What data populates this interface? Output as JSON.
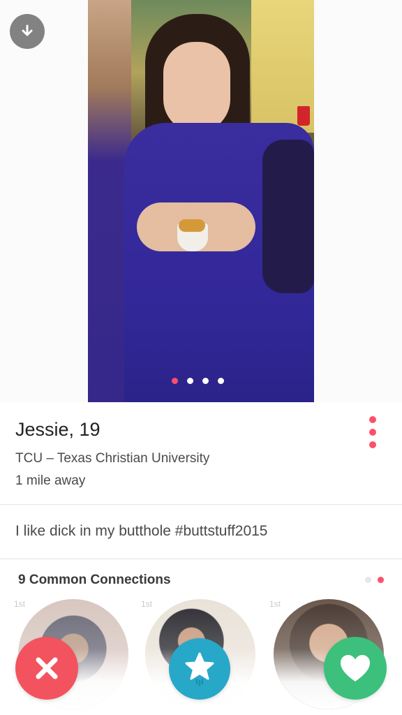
{
  "profile": {
    "name": "Jessie",
    "age_suffix": ", 19",
    "school": "TCU – Texas Christian University",
    "distance": "1 mile away",
    "bio": "I like dick in my butthole #buttstuff2015"
  },
  "photo_carousel": {
    "count": 4,
    "active_index": 0
  },
  "connections": {
    "title": "9 Common Connections",
    "pages": 2,
    "active_page": 1,
    "items": [
      {
        "degree": "1st"
      },
      {
        "degree": "1st"
      },
      {
        "degree": "1st"
      }
    ]
  },
  "icons": {
    "download": "download-icon",
    "more": "more-options-icon",
    "nope": "close-icon",
    "superlike": "star-icon",
    "like": "heart-icon"
  },
  "colors": {
    "accent": "#fd5068",
    "nope": "#f3535e",
    "superlike": "#27a8c9",
    "like": "#3cc07c"
  }
}
